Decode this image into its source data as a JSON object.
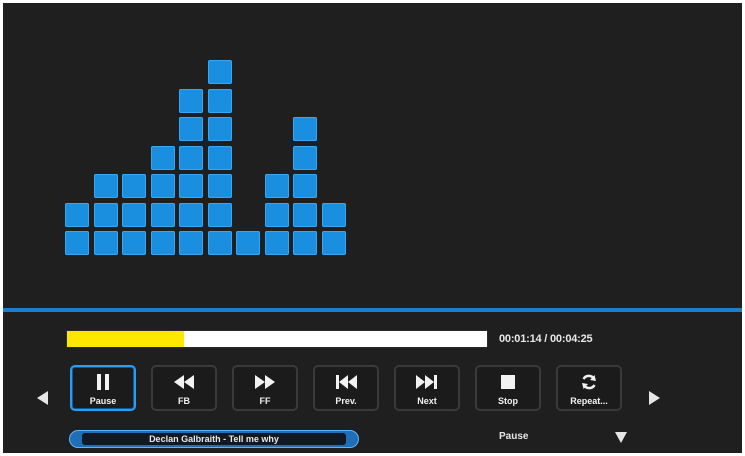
{
  "player": {
    "elapsed_time": "00:01:14",
    "total_time": "00:04:25",
    "time_separator": " / ",
    "progress_percent": 27.9,
    "status": "Pause",
    "track_title": "Declan Galbraith - Tell me why"
  },
  "visualizer": {
    "bar_levels": [
      2,
      3,
      3,
      4,
      6,
      7,
      1,
      3,
      5,
      2
    ],
    "max_level": 7,
    "color": "#1a8fe0"
  },
  "controls": [
    {
      "name": "pause",
      "label": "Pause",
      "icon": "pause-icon",
      "active": true
    },
    {
      "name": "fast-rewind",
      "label": "FB",
      "icon": "fast-rewind-icon",
      "active": false
    },
    {
      "name": "fast-forward",
      "label": "FF",
      "icon": "fast-forward-icon",
      "active": false
    },
    {
      "name": "previous",
      "label": "Prev.",
      "icon": "skip-previous-icon",
      "active": false
    },
    {
      "name": "next",
      "label": "Next",
      "icon": "skip-next-icon",
      "active": false
    },
    {
      "name": "stop",
      "label": "Stop",
      "icon": "stop-icon",
      "active": false
    },
    {
      "name": "repeat",
      "label": "Repeat...",
      "icon": "repeat-icon",
      "active": false
    }
  ],
  "colors": {
    "accent": "#1a8fe0",
    "progress_fill": "#ffe800",
    "background": "#1f1f1f"
  }
}
